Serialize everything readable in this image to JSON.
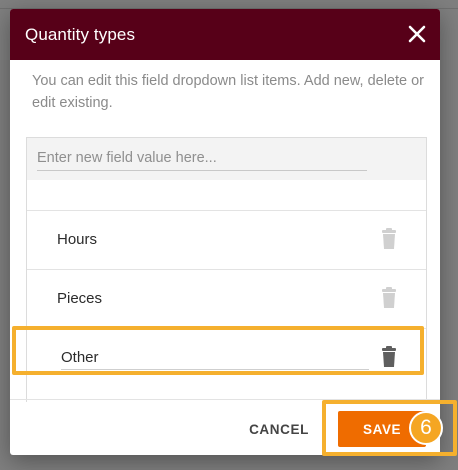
{
  "dialog": {
    "title": "Quantity types",
    "close_icon": "close-icon",
    "description": "You can edit this field dropdown list items. Add new, delete or edit existing.",
    "new_value_placeholder": "Enter new field value here...",
    "items": [
      {
        "label": "Hours",
        "icon": "trash-icon",
        "state": "disabled"
      },
      {
        "label": "Pieces",
        "icon": "trash-icon",
        "state": "disabled"
      },
      {
        "label": "Other",
        "icon": "trash-icon",
        "state": "editing"
      }
    ],
    "cancel_label": "CANCEL",
    "save_label": "SAVE"
  },
  "annotation": {
    "step_number": "6",
    "color": "#f5b02e"
  },
  "colors": {
    "header": "#570018",
    "save_button": "#ef6c00",
    "backdrop": "#7f7f7f"
  }
}
